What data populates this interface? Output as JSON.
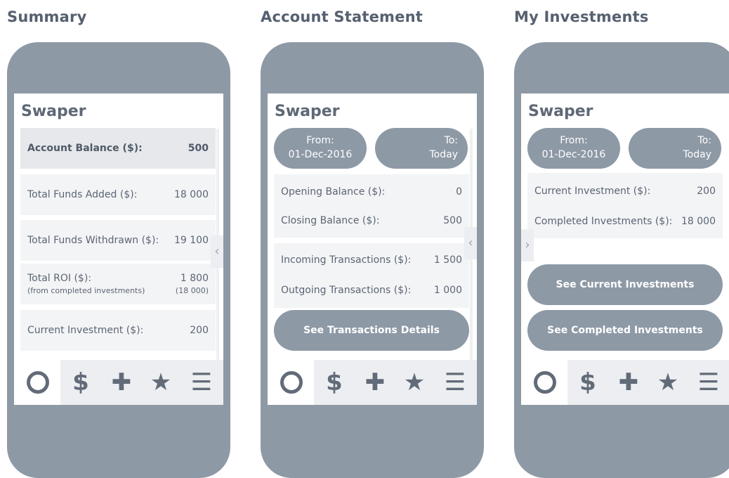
{
  "panels": {
    "summary": {
      "title": "Summary",
      "brand": "Swaper",
      "rows": [
        {
          "label": "Account Balance ($):",
          "value": "500"
        },
        {
          "label": "Total Funds Added ($):",
          "value": "18 000"
        },
        {
          "label": "Total Funds Withdrawn ($):",
          "value": "19 100"
        },
        {
          "label": "Total ROI ($):",
          "sublabel": "(from completed investments)",
          "value": "1 800",
          "subvalue": "(18 000)"
        },
        {
          "label": "Current Investment ($):",
          "value": "200"
        }
      ]
    },
    "statement": {
      "title": "Account Statement",
      "brand": "Swaper",
      "from_label": "From:",
      "from_value": "01-Dec-2016",
      "to_label": "To:",
      "to_value": "Today",
      "balances": [
        {
          "label": "Opening Balance ($):",
          "value": "0"
        },
        {
          "label": "Closing Balance ($):",
          "value": "500"
        }
      ],
      "transactions": [
        {
          "label": "Incoming Transactions ($):",
          "value": "1 500"
        },
        {
          "label": "Outgoing Transactions ($):",
          "value": "1 000"
        }
      ],
      "details_button": "See Transactions Details"
    },
    "investments": {
      "title": "My Investments",
      "brand": "Swaper",
      "from_label": "From:",
      "from_value": "01-Dec-2016",
      "to_label": "To:",
      "to_value": "Today",
      "rows": [
        {
          "label": "Current Investment ($):",
          "value": "200"
        },
        {
          "label": "Completed Investments ($):",
          "value": "18 000"
        }
      ],
      "current_button": "See Current Investments",
      "completed_button": "See Completed Investments"
    }
  },
  "nav": {
    "dollar": "$",
    "plus": "✚",
    "star": "★",
    "menu": "☰",
    "chevron_left": "‹",
    "chevron_right": "›"
  },
  "colors": {
    "phone": "#8e99a6",
    "row_bg": "#f3f4f6",
    "highlight_bg": "#e6e8eb",
    "text": "#5c6573"
  }
}
